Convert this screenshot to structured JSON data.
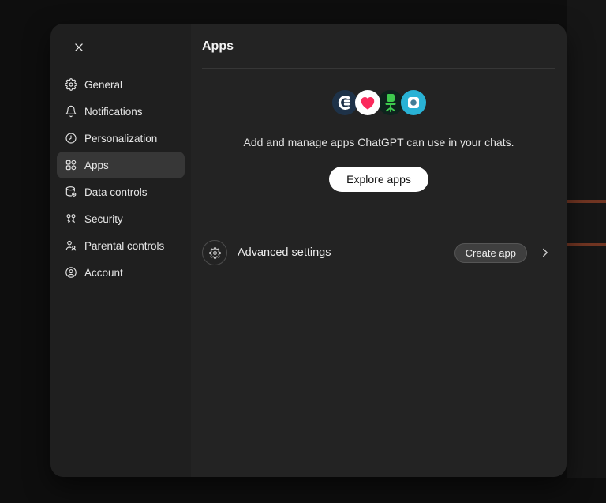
{
  "sidebar": {
    "close_icon": "close-icon",
    "items": [
      {
        "label": "General",
        "icon": "gear-icon"
      },
      {
        "label": "Notifications",
        "icon": "bell-icon"
      },
      {
        "label": "Personalization",
        "icon": "clock-dial-icon"
      },
      {
        "label": "Apps",
        "icon": "apps-grid-icon",
        "selected": true
      },
      {
        "label": "Data controls",
        "icon": "database-gear-icon"
      },
      {
        "label": "Security",
        "icon": "keys-icon"
      },
      {
        "label": "Parental controls",
        "icon": "people-icon"
      },
      {
        "label": "Account",
        "icon": "user-circle-icon"
      }
    ]
  },
  "main": {
    "title": "Apps",
    "app_preview_icons": [
      "c-logo-app-icon",
      "heart-app-icon",
      "office-chair-app-icon",
      "dot-square-app-icon"
    ],
    "description": "Add and manage apps ChatGPT can use in your chats.",
    "explore_button_label": "Explore apps",
    "advanced": {
      "label": "Advanced settings",
      "create_button_label": "Create app",
      "chevron": "chevron-right-icon"
    }
  },
  "colors": {
    "modal_sidebar_bg": "#1f1f1f",
    "modal_main_bg": "#232323",
    "selected_item_bg": "#373737",
    "page_bg": "#0e0e0e",
    "rust_line": "#713522",
    "app1_navy": "#1e3248",
    "app1_glyph": "#ffffff",
    "app2_white": "#ffffff",
    "app2_heart": "#fb2a5c",
    "app3_bg": "#0e231d",
    "app3_chair": "#3ecb4e",
    "app4_cyan": "#29b2d5",
    "app4_square": "#ffffff",
    "app4_dot": "#447e97",
    "explore_btn_bg": "#ffffff",
    "explore_btn_text": "#0d0d0d",
    "create_btn_bg": "#3f3f3f"
  }
}
